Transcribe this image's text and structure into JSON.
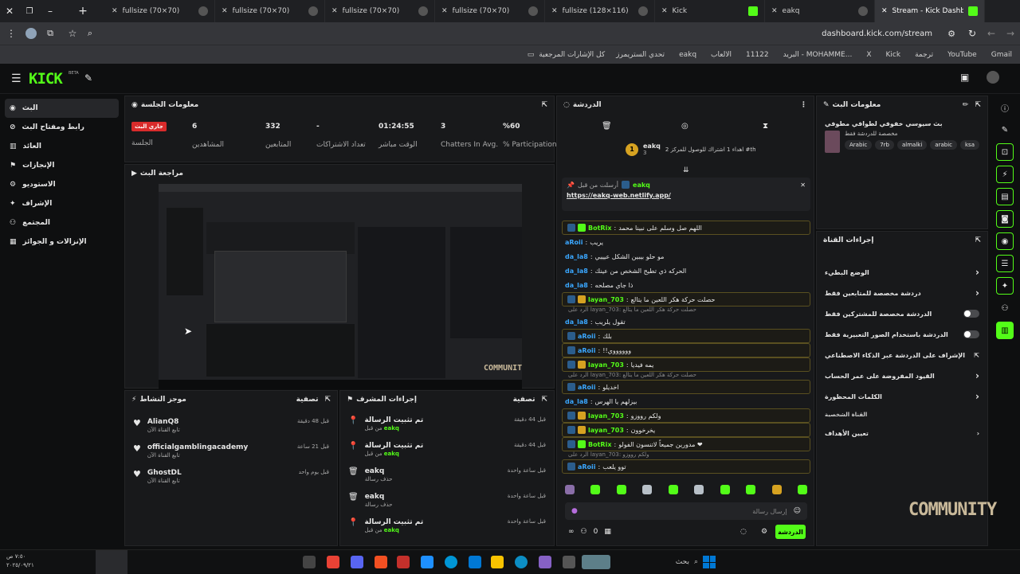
{
  "browser": {
    "tabs": [
      {
        "title": "fullsize (70×70)",
        "active": false
      },
      {
        "title": "fullsize (70×70)",
        "active": false
      },
      {
        "title": "fullsize (70×70)",
        "active": false
      },
      {
        "title": "fullsize (70×70)",
        "active": false
      },
      {
        "title": "fullsize (128×116)",
        "active": false
      },
      {
        "title": "Kick",
        "active": false
      },
      {
        "title": "eakq",
        "active": false
      },
      {
        "title": "Stream - Kick Dashboard",
        "active": true
      }
    ],
    "url": "dashboard.kick.com/stream",
    "bookmarks": [
      "Gmail",
      "YouTube",
      "ترجمة",
      "Kick",
      "X",
      "البريد - MOHAMME...",
      "11122",
      "الالعاب",
      "eakq",
      "تحدي الستريمرز"
    ],
    "bookmarks_folder": "كل الإشارات المرجعية"
  },
  "brand": {
    "logo": "KICK",
    "beta": "BETA",
    "accent": "#53fc18"
  },
  "sidebar": {
    "items": [
      {
        "label": "البث",
        "active": true
      },
      {
        "label": "رابط ومفتاح البث"
      },
      {
        "label": "العائد"
      },
      {
        "label": "الإنجازات"
      },
      {
        "label": "الاستوديو"
      },
      {
        "label": "الإشراف"
      },
      {
        "label": "المجتمع"
      },
      {
        "label": "الإنزالات و الجوائز"
      }
    ]
  },
  "session": {
    "title": "معلومات الجلسة",
    "live_badge": "جاري البث",
    "live_label": "الجلسة",
    "stats": [
      {
        "value": "6",
        "label": "المشاهدين"
      },
      {
        "value": "332",
        "label": "المتابعين"
      },
      {
        "value": "-",
        "label": "تعداد الاشتراكات"
      },
      {
        "value": "01:24:55",
        "label": "الوقت مباشر"
      },
      {
        "value": "3",
        "label": "Chatters In Avg."
      },
      {
        "value": "%60",
        "label": "% Participation"
      }
    ]
  },
  "preview": {
    "title": "مراجعة البث",
    "watermark": "COMMUNITY"
  },
  "activity": {
    "title": "موجز النشاط",
    "filter": "تصفية",
    "items": [
      {
        "name": "AlianQ8",
        "sub": "تابع القناة الآن",
        "time": "قبل 48 دقيقة"
      },
      {
        "name": "officialgamblingacademy",
        "sub": "تابع القناة الآن",
        "time": "قبل 21 ساعة"
      },
      {
        "name": "GhostDL",
        "sub": "تابع القناة الآن",
        "time": "قبل يوم واحد"
      }
    ]
  },
  "mod_actions": {
    "title": "إجراءات المشرف",
    "filter": "تصفية",
    "items": [
      {
        "action": "تم تثبيت الرسالة",
        "by_prefix": "من قبل",
        "by": "eakq",
        "time": "قبل 44 دقيقة"
      },
      {
        "action": "تم تثبيت الرسالة",
        "by_prefix": "من قبل",
        "by": "eakq",
        "time": "قبل 44 دقيقة"
      },
      {
        "action": "eakq",
        "by_prefix": "حذف رسالة",
        "by": "",
        "time": "قبل ساعة واحدة"
      },
      {
        "action": "eakq",
        "by_prefix": "حذف رسالة",
        "by": "",
        "time": "قبل ساعة واحدة"
      },
      {
        "action": "تم تثبيت الرسالة",
        "by_prefix": "من قبل",
        "by": "eakq",
        "time": "قبل ساعة واحدة"
      }
    ]
  },
  "chat": {
    "title": "الدردشة",
    "leader_name": "eakq",
    "leader_count": "3",
    "leader_note": "اهداء 1 اشتراك للوصول للمركز 2 #th",
    "pinned_label": "أرسلت من قبل",
    "pinned_user": "eakq",
    "pinned_link": "https://eakq-web.netlify.app/",
    "messages": [
      {
        "user": "BotRix",
        "text": "اللهم صل وسلم على نبينا محمد",
        "color": "#53fc18",
        "hl": true,
        "reply": ""
      },
      {
        "user": "aRoii",
        "text": "يريب",
        "color": "#3aa7ff",
        "hl": false,
        "reply": ""
      },
      {
        "user": "da_la8",
        "text": "مو حلو بيبين الشكل عيييي",
        "color": "#3aa7ff",
        "hl": false,
        "reply": ""
      },
      {
        "user": "da_la8",
        "text": "الحركه ذي تطيح الشخص من عينك",
        "color": "#3aa7ff",
        "hl": false,
        "reply": ""
      },
      {
        "user": "da_la8",
        "text": "ذا جاي مصلحه",
        "color": "#3aa7ff",
        "hl": false,
        "reply": ""
      },
      {
        "user": "layan_703",
        "text": "حصلت حركة هكر اللعين ما يتالع",
        "color": "#53fc18",
        "hl": true,
        "reply": ""
      },
      {
        "user": "da_la8",
        "text": "تقول يلريب",
        "color": "#3aa7ff",
        "hl": false,
        "reply": "الرد على layan_703: حصلت حركة هكر اللعين ما يتالع"
      },
      {
        "user": "aRoii",
        "text": "بلك",
        "color": "#3aa7ff",
        "hl": true,
        "reply": ""
      },
      {
        "user": "aRoii",
        "text": "!!ووووووي",
        "color": "#3aa7ff",
        "hl": true,
        "reply": ""
      },
      {
        "user": "layan_703",
        "text": "يمه فيديا",
        "color": "#53fc18",
        "hl": true,
        "reply": ""
      },
      {
        "user": "aRoii",
        "text": "اخديلو",
        "color": "#3aa7ff",
        "hl": true,
        "reply": "الرد على layan_703: حصلت حركة هكر اللعين ما يتالع"
      },
      {
        "user": "da_la8",
        "text": "بيزلهم يا الهرس",
        "color": "#3aa7ff",
        "hl": false,
        "reply": ""
      },
      {
        "user": "layan_703",
        "text": "ولكم رووزو",
        "color": "#53fc18",
        "hl": true,
        "reply": ""
      },
      {
        "user": "layan_703",
        "text": "يخرخوون",
        "color": "#53fc18",
        "hl": true,
        "reply": ""
      },
      {
        "user": "BotRix",
        "text": "مدورين جميعاً لاتنسون الفولو ❤",
        "color": "#53fc18",
        "hl": true,
        "reply": ""
      },
      {
        "user": "aRoii",
        "text": "توو يلعب",
        "color": "#3aa7ff",
        "hl": true,
        "reply": "الرد على layan_703: ولكم رووزو"
      }
    ],
    "input_placeholder": "إرسال رسالة",
    "send_label": "الدردشة",
    "counter": "0"
  },
  "stream_info": {
    "title": "معلومات البث",
    "stream_title": "بث سيوسي خفوفي لطوافي مطوفي",
    "category": "مخصصة للدردشة فقط",
    "tags": [
      "Arabic",
      "7rb",
      "almalki",
      "arabic",
      "ksa"
    ]
  },
  "channel_actions": {
    "title": "إجراءات القناة",
    "rows": [
      {
        "label": "الوضع البطيء",
        "control": "chevron"
      },
      {
        "label": "دردشة مخصصة للمتابعين فقط",
        "control": "chevron"
      },
      {
        "label": "الدردشة مخصصة للمشتركين فقط",
        "control": "toggle"
      },
      {
        "label": "الدردشة باستخدام الصور التعبيرية فقط",
        "control": "toggle"
      },
      {
        "label": "الإشراف على الدردشة عبر الذكاء الاصطناعي",
        "control": "external"
      },
      {
        "label": "القيود المفروضة على عمر الحساب",
        "control": "chevron"
      },
      {
        "label": "الكلمات المحظورة",
        "control": "chevron"
      }
    ],
    "section": "القناة الشخصية",
    "goals": "تعيين الأهداف"
  },
  "taskbar": {
    "search": "بحث",
    "time": "٧:٥٠ ص",
    "date": "٢٠٢٥/٠٩/٢١"
  }
}
